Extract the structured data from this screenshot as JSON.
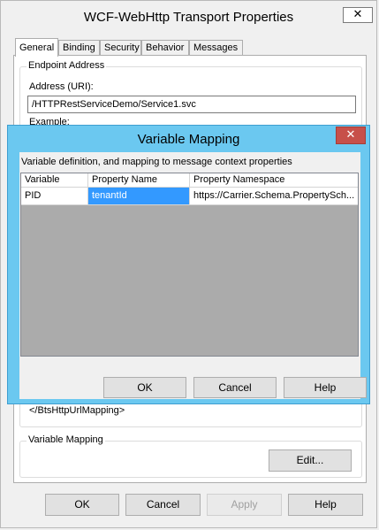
{
  "outer": {
    "title": "WCF-WebHttp Transport Properties",
    "close_glyph": "✕",
    "tabs": [
      {
        "label": "General"
      },
      {
        "label": "Binding"
      },
      {
        "label": "Security"
      },
      {
        "label": "Behavior"
      },
      {
        "label": "Messages"
      }
    ],
    "endpoint": {
      "group_label": "Endpoint Address",
      "address_label": "Address (URI):",
      "address_value": "/HTTPRestServiceDemo/Service1.svc",
      "example_label": "Example:",
      "mapping_text": "</BtsHttpUrlMapping>"
    },
    "variable_mapping": {
      "group_label": "Variable Mapping",
      "edit_button": "Edit..."
    },
    "buttons": {
      "ok": "OK",
      "cancel": "Cancel",
      "apply": "Apply",
      "help": "Help"
    }
  },
  "modal": {
    "title": "Variable Mapping",
    "close_glyph": "✕",
    "description": "Variable definition, and mapping to message context properties",
    "columns": [
      "Variable",
      "Property Name",
      "Property Namespace"
    ],
    "rows": [
      {
        "variable": "PID",
        "property_name": "tenantId",
        "property_namespace": "https://Carrier.Schema.PropertySch..."
      }
    ],
    "buttons": {
      "ok": "OK",
      "cancel": "Cancel",
      "help": "Help"
    }
  },
  "colors": {
    "modal_frame": "#6bc8f0",
    "selection": "#3399ff",
    "close_red": "#c7504a"
  }
}
